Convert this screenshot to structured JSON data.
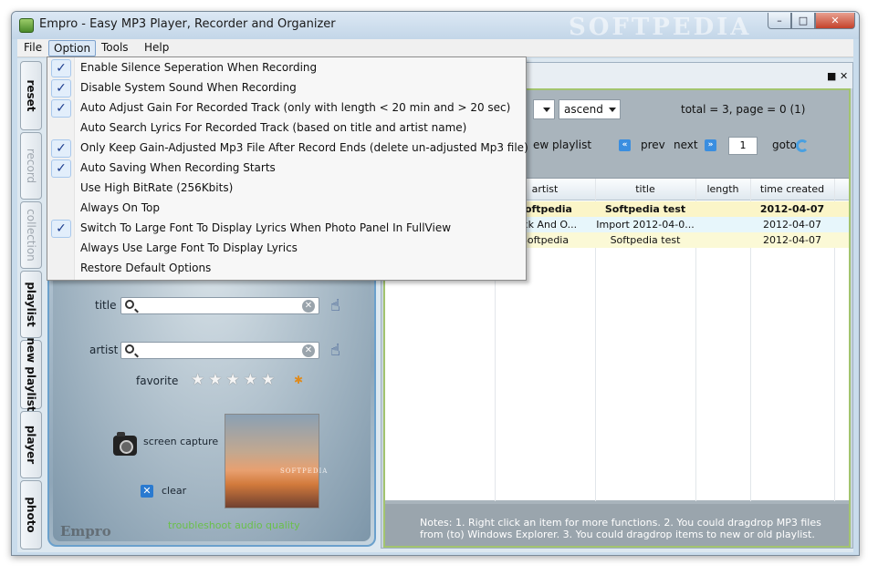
{
  "window": {
    "title": "Empro - Easy MP3 Player, Recorder and Organizer",
    "watermark": "SOFTPEDIA",
    "controls": {
      "minimize": "–",
      "maximize": "□",
      "close": "✕"
    }
  },
  "menubar": [
    {
      "label": "File"
    },
    {
      "label": "Option"
    },
    {
      "label": "Tools"
    },
    {
      "label": "Help"
    }
  ],
  "option_menu": [
    {
      "label": "Enable Silence Seperation When Recording",
      "checked": true
    },
    {
      "label": "Disable System Sound When Recording",
      "checked": true
    },
    {
      "label": "Auto Adjust Gain For Recorded Track (only with length < 20 min and > 20 sec)",
      "checked": true
    },
    {
      "label": "Auto Search Lyrics For Recorded Track (based on title and artist name)",
      "checked": false
    },
    {
      "label": "Only Keep Gain-Adjusted Mp3 File After Record Ends (delete un-adjusted Mp3 file)",
      "checked": true
    },
    {
      "label": "Auto Saving When Recording Starts",
      "checked": true
    },
    {
      "label": "Use High BitRate (256Kbits)",
      "checked": false
    },
    {
      "label": "Always On Top",
      "checked": false
    },
    {
      "label": "Switch To Large Font To Display Lyrics When Photo Panel In FullView",
      "checked": true
    },
    {
      "label": "Always Use Large Font To Display Lyrics",
      "checked": false
    },
    {
      "label": "Restore Default Options",
      "checked": false
    }
  ],
  "vtabs": [
    {
      "label": "reset",
      "disabled": false
    },
    {
      "label": "record",
      "disabled": true
    },
    {
      "label": "collection",
      "disabled": true
    },
    {
      "label": "playlist",
      "disabled": false
    },
    {
      "label": "new playlist",
      "disabled": false
    },
    {
      "label": "player",
      "disabled": false
    },
    {
      "label": "photo",
      "disabled": false
    }
  ],
  "left_panel": {
    "title_label": "title",
    "title_value": "",
    "artist_label": "artist",
    "artist_value": "",
    "favorite_label": "favorite",
    "stars": "★★★★★",
    "screen_capture": "screen capture",
    "clear": "clear",
    "troubleshoot": "troubleshoot audio quality",
    "logo": "Empro",
    "photo_watermark": "SOFTPEDIA"
  },
  "right_panel": {
    "header_buttons": {
      "restore": "■",
      "close": "✕"
    },
    "sort_order": "ascend",
    "total_text": "total = 3, page = 0 (1)",
    "new_playlist_text": "ew playlist",
    "prev": "prev",
    "next": "next",
    "page_number": "1",
    "goto": "goto",
    "columns": [
      "artist",
      "title",
      "length",
      "time created"
    ],
    "rows": [
      {
        "artist": "Softpedia",
        "title": "Softpedia test",
        "length": "",
        "time_created": "2012-04-07"
      },
      {
        "artist": "Rick And O...",
        "title": "Import 2012-04-0...",
        "length": "",
        "time_created": "2012-04-07"
      },
      {
        "artist": "Softpedia",
        "title": "Softpedia test",
        "length": "",
        "time_created": "2012-04-07"
      }
    ],
    "notes": "Notes: 1. Right click an item for more functions. 2. You could dragdrop MP3 files from (to) Windows Explorer. 3. You could dragdrop items to new or old playlist."
  }
}
